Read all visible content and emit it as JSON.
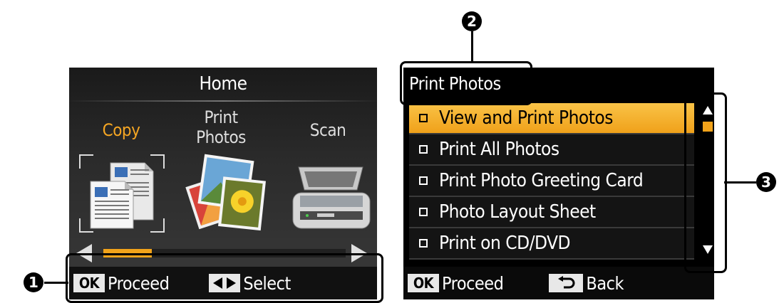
{
  "home_screen": {
    "title": "Home",
    "menu": [
      {
        "label": "Copy",
        "selected": true,
        "icon": "copy-documents-icon"
      },
      {
        "label": "Print\nPhotos",
        "selected": false,
        "icon": "photos-icon"
      },
      {
        "label": "Scan",
        "selected": false,
        "icon": "scanner-icon"
      }
    ],
    "slider_position": 0.2,
    "footer": {
      "ok_key": "OK",
      "ok_label": "Proceed",
      "lr_label": "Select"
    }
  },
  "print_photos_screen": {
    "title": "Print Photos",
    "items": [
      {
        "label": "View and Print Photos",
        "selected": true
      },
      {
        "label": "Print All Photos",
        "selected": false
      },
      {
        "label": "Print Photo Greeting Card",
        "selected": false
      },
      {
        "label": "Photo Layout Sheet",
        "selected": false
      },
      {
        "label": "Print on CD/DVD",
        "selected": false
      }
    ],
    "footer": {
      "ok_key": "OK",
      "ok_label": "Proceed",
      "back_label": "Back"
    }
  },
  "callouts": [
    "1",
    "2",
    "3"
  ],
  "colors": {
    "accent": "#f2a31a",
    "background": "#000000",
    "text": "#ffffff"
  }
}
